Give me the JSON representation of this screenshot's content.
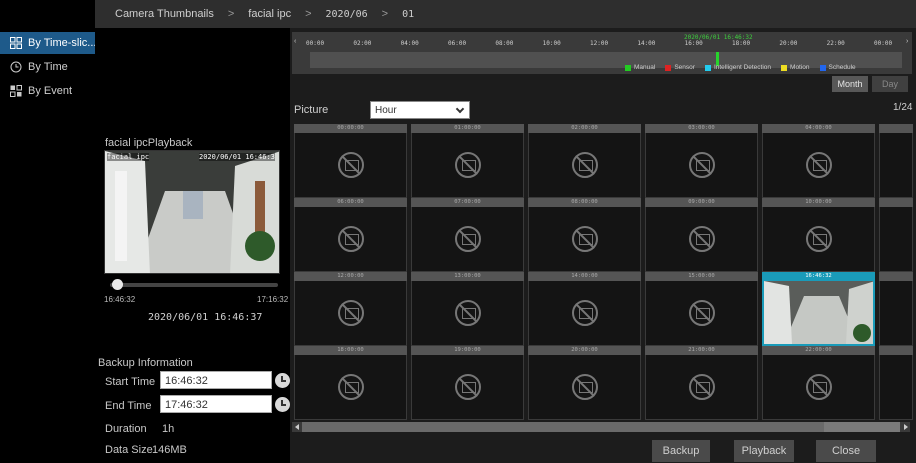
{
  "breadcrumb": {
    "root": "Camera Thumbnails",
    "camera": "facial ipc",
    "month": "2020/06",
    "day": "01",
    "sep": ">"
  },
  "sidebar": {
    "items": [
      {
        "label": "By Time-slic...",
        "icon": "time-slice-icon",
        "active": true
      },
      {
        "label": "By Time",
        "icon": "clock-icon",
        "active": false
      },
      {
        "label": "By Event",
        "icon": "event-grid-icon",
        "active": false
      }
    ]
  },
  "playback": {
    "title": "facial ipcPlayback",
    "osd_camera": "facial ipc",
    "osd_time": "2020/06/01 16:46:3",
    "start": "16:46:32",
    "end": "17:16:32",
    "current": "2020/06/01 16:46:37",
    "progress": 0.03
  },
  "backup": {
    "title": "Backup Information",
    "start_label": "Start Time",
    "start_value": "16:46:32",
    "end_label": "End Time",
    "end_value": "17:46:32",
    "duration_label": "Duration",
    "duration_value": "1h",
    "size_label": "Data Size",
    "size_value": "146MB"
  },
  "timeline": {
    "marker_label": "2020/06/01 16:46:32",
    "ticks": [
      "00:00",
      "02:00",
      "04:00",
      "06:00",
      "08:00",
      "10:00",
      "12:00",
      "14:00",
      "16:00",
      "18:00",
      "20:00",
      "22:00",
      "00:00"
    ],
    "legend": [
      {
        "label": "Manual",
        "color": "#22cc22"
      },
      {
        "label": "Sensor",
        "color": "#dd2222"
      },
      {
        "label": "Intelligent Detection",
        "color": "#22ccee"
      },
      {
        "label": "Motion",
        "color": "#eedd22"
      },
      {
        "label": "Schedule",
        "color": "#2266ee"
      }
    ],
    "month_label": "Month",
    "day_label": "Day"
  },
  "grid": {
    "picture_label": "Picture",
    "unit_value": "Hour",
    "page": "1/24",
    "rows": [
      [
        "00:00:00",
        "01:00:00",
        "02:00:00",
        "03:00:00",
        "04:00:00"
      ],
      [
        "06:00:00",
        "07:00:00",
        "08:00:00",
        "09:00:00",
        "10:00:00"
      ],
      [
        "12:00:00",
        "13:00:00",
        "14:00:00",
        "15:00:00",
        "16:46:32"
      ],
      [
        "18:00:00",
        "19:00:00",
        "20:00:00",
        "21:00:00",
        "22:00:00"
      ]
    ],
    "selected": "16:46:32"
  },
  "buttons": {
    "backup": "Backup",
    "playback": "Playback",
    "close": "Close"
  }
}
